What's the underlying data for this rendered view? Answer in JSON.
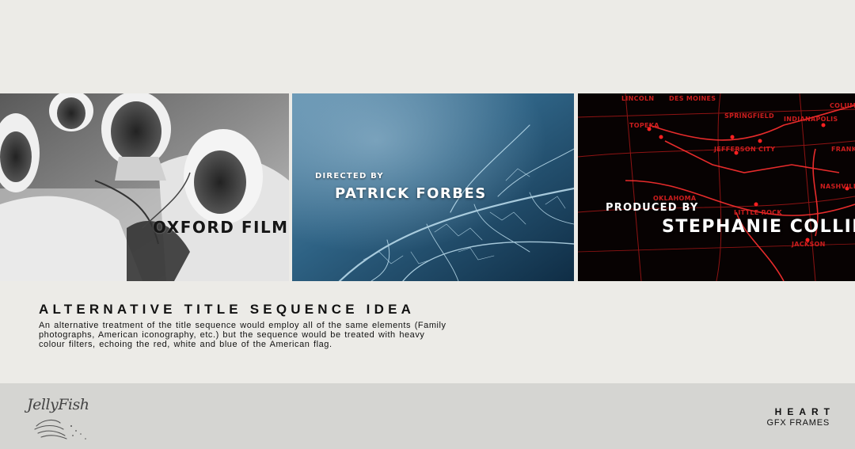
{
  "frames": [
    {
      "id": "oxford",
      "title": "OXFORD FILMS"
    },
    {
      "id": "director",
      "label": "DIRECTED BY",
      "name": "PATRICK FORBES"
    },
    {
      "id": "producer",
      "label": "PRODUCED BY",
      "name": "STEPHANIE COLLINS",
      "map_labels": [
        "LINCOLN",
        "DES MOINES",
        "COLUMB",
        "TOPEKA",
        "SPRINGFIELD",
        "INDIANAPOLIS",
        "FRANKF",
        "JEFFERSON CITY",
        "NASHVILLE",
        "OKLAHOMA",
        "LITTLE ROCK",
        "JACKSON"
      ]
    }
  ],
  "info": {
    "heading": "ALTERNATIVE TITLE SEQUENCE IDEA",
    "body": "An alternative treatment of the title sequence would employ all of the same elements (Family photographs, American iconography, etc.) but the sequence would be treated with heavy colour filters, echoing the red, white and blue of the American flag."
  },
  "footer": {
    "logo_text": "JellyFish",
    "brand_name": "HEART",
    "brand_sub": "GFX FRAMES"
  },
  "colors": {
    "page_bg": "#ecebe7",
    "footer_bg": "#d5d5d2",
    "map_red": "#e02020",
    "leaf_blue": "#2b5a7a"
  }
}
